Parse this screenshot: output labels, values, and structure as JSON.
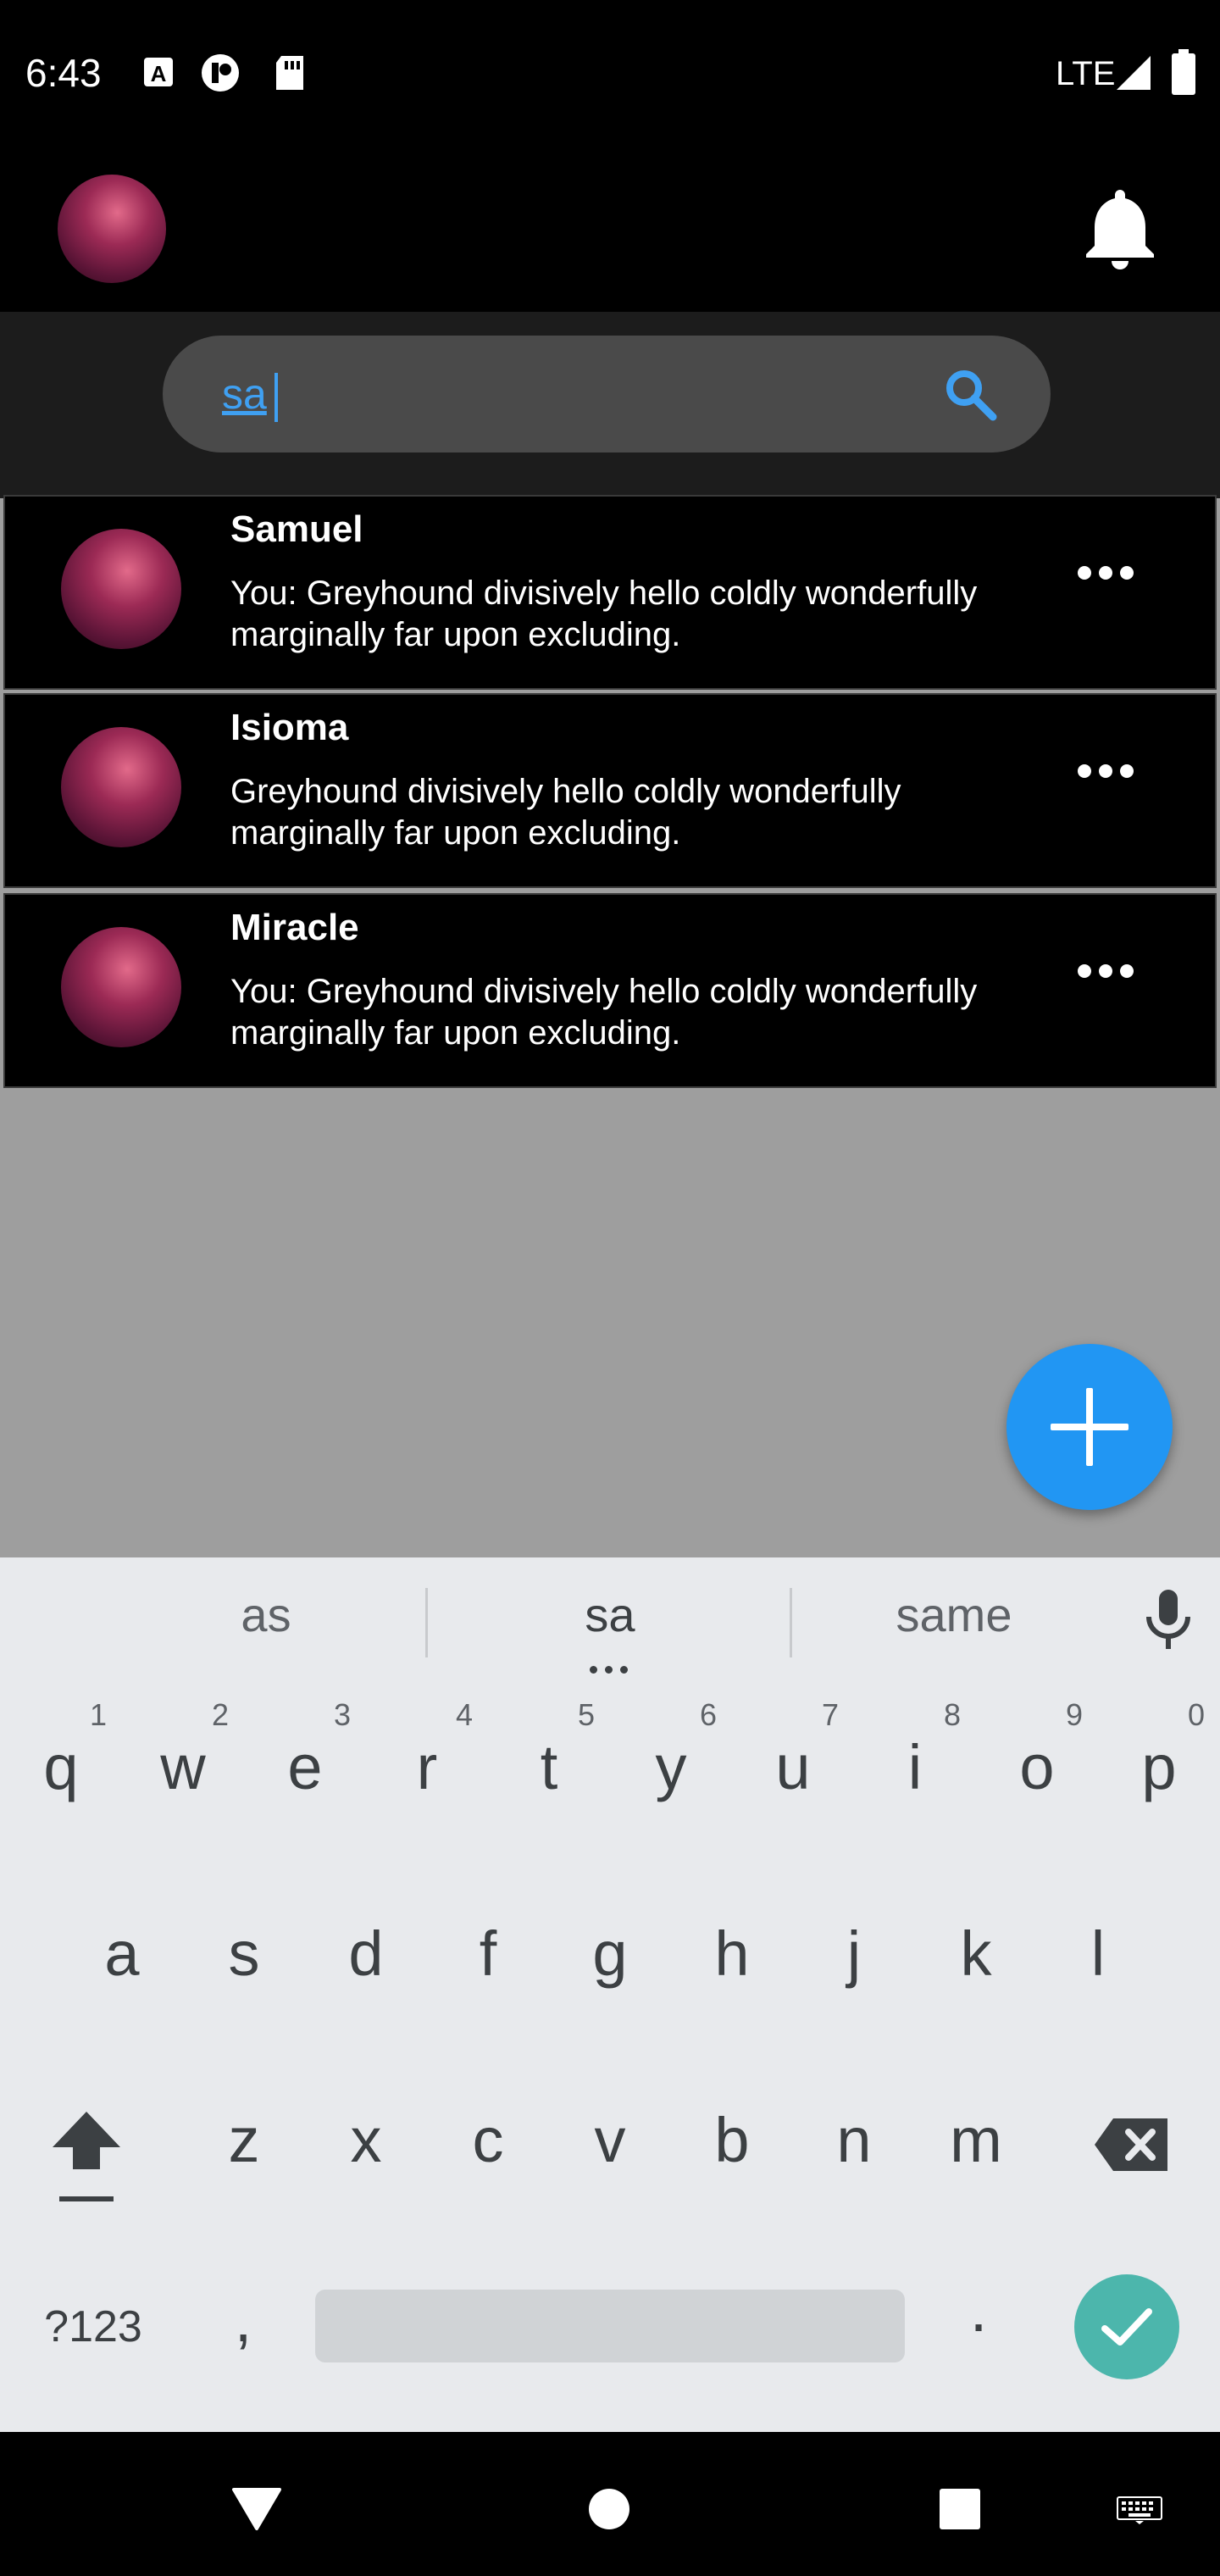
{
  "status_bar": {
    "time": "6:43",
    "network": "LTE",
    "icons": [
      "keyboard-a-icon",
      "app-icon",
      "sd-card-icon",
      "signal-icon",
      "battery-icon"
    ]
  },
  "header": {
    "avatar": "profile-avatar",
    "notification_icon": "bell-icon"
  },
  "search": {
    "value": "sa",
    "icon": "search-icon",
    "accent_color": "#3fa0f2"
  },
  "conversations": [
    {
      "name": "Samuel",
      "message": "You: Greyhound divisively hello coldly wonderfully marginally far upon excluding."
    },
    {
      "name": "Isioma",
      "message": "Greyhound divisively hello coldly wonderfully marginally far upon excluding."
    },
    {
      "name": "Miracle",
      "message": "You: Greyhound divisively hello coldly wonderfully marginally far upon excluding."
    }
  ],
  "fab": {
    "icon": "plus-icon",
    "color": "#2196f3"
  },
  "keyboard": {
    "suggestions": [
      "as",
      "sa",
      "same"
    ],
    "row1": [
      "q",
      "w",
      "e",
      "r",
      "t",
      "y",
      "u",
      "i",
      "o",
      "p"
    ],
    "row1_numbers": [
      "1",
      "2",
      "3",
      "4",
      "5",
      "6",
      "7",
      "8",
      "9",
      "0"
    ],
    "row2": [
      "a",
      "s",
      "d",
      "f",
      "g",
      "h",
      "j",
      "k",
      "l"
    ],
    "row3": [
      "z",
      "x",
      "c",
      "v",
      "b",
      "n",
      "m"
    ],
    "symbols_label": "?123",
    "comma": ",",
    "period": ".",
    "enter_color": "#4cb6ac"
  }
}
